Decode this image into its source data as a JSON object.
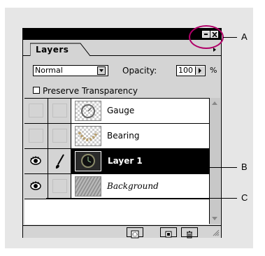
{
  "palette": {
    "tab_label": "Layers",
    "blend_mode": "Normal",
    "opacity_label": "Opacity:",
    "opacity_value": "100",
    "opacity_unit": "%",
    "preserve_transparency_label": "Preserve Transparency",
    "preserve_transparency_checked": false
  },
  "layers": [
    {
      "name": "Gauge",
      "visible": false,
      "brush": false,
      "selected": false
    },
    {
      "name": "Bearing",
      "visible": false,
      "brush": false,
      "selected": false
    },
    {
      "name": "Layer 1",
      "visible": true,
      "brush": true,
      "selected": true
    },
    {
      "name": "Background",
      "visible": true,
      "brush": false,
      "selected": false
    }
  ],
  "callouts": {
    "a": "A",
    "b": "B",
    "c": "C"
  },
  "colors": {
    "callout_circle": "#b00068",
    "panel_bg": "#e6e6e6",
    "palette_bg": "#d4d4d4",
    "selected_row": "#000000"
  },
  "icons": {
    "minimize": "minimize-icon",
    "close": "close-icon",
    "flyout": "triangle-right-icon",
    "visibility": "eye-icon",
    "link": "paintbrush-icon",
    "add_mask": "layer-mask-icon",
    "new_layer": "new-layer-icon",
    "delete": "trash-icon"
  }
}
